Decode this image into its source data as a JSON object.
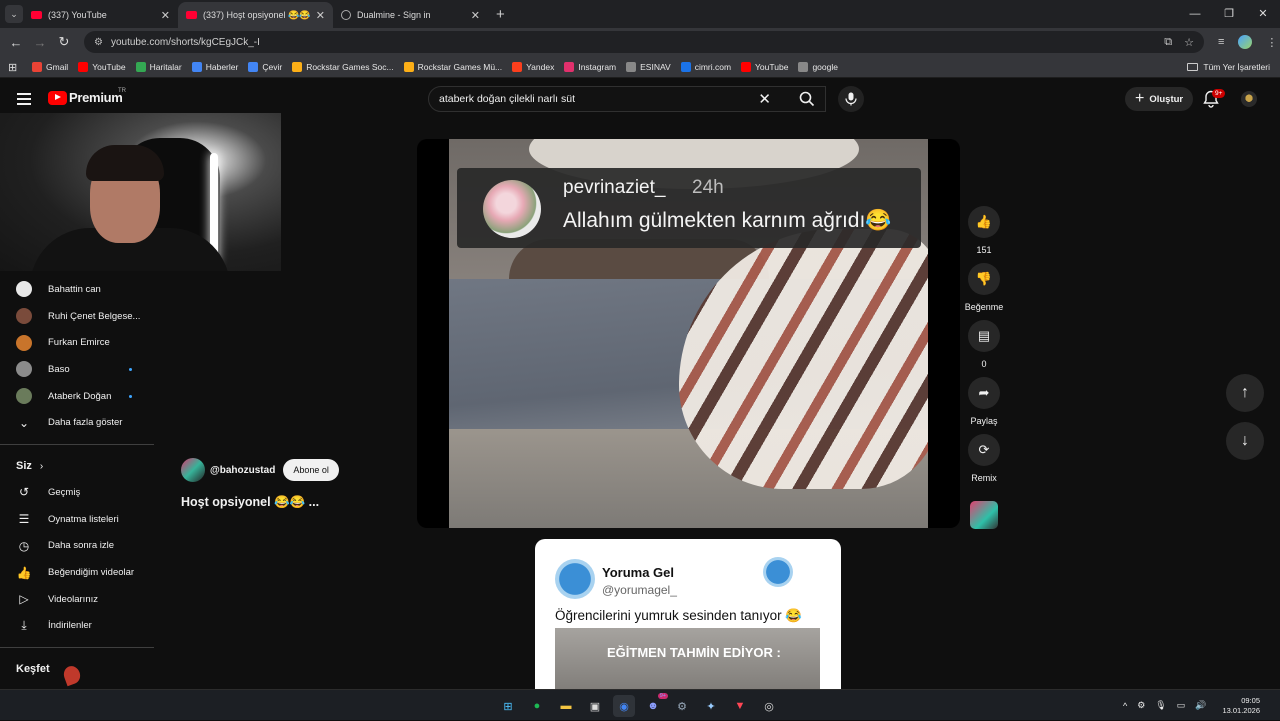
{
  "browser": {
    "tabs": [
      {
        "title": "(337) YouTube",
        "active": false
      },
      {
        "title": "(337) Hoşt opsiyonel 😂😂",
        "active": true
      },
      {
        "title": "Dualmine - Sign in",
        "active": false
      }
    ],
    "url": "youtube.com/shorts/kgCEgJCk_-I",
    "bookmarks": [
      "Gmail",
      "YouTube",
      "Haritalar",
      "Haberler",
      "Çevir",
      "Rockstar Games Soc...",
      "Rockstar Games Mü...",
      "Yandex",
      "Instagram",
      "ESINAV",
      "cimri.com",
      "YouTube",
      "google"
    ],
    "bookmark_colors": [
      "#ea4335",
      "#ff0000",
      "#34a853",
      "#4285f4",
      "#4285f4",
      "#fcaf17",
      "#fcaf17",
      "#fc3f1d",
      "#e1306c",
      "#888888",
      "#1b73e8",
      "#ff0000",
      "#888888"
    ],
    "all_bookmarks": "Tüm Yer İşaretleri"
  },
  "youtube": {
    "logo_text": "Premium",
    "region": "TR",
    "search_query": "ataberk doğan çilekli narlı süt",
    "create_label": "Oluştur",
    "notif_badge": "9+"
  },
  "sidebar": {
    "subscriptions": [
      {
        "label": "Bahattin can",
        "color": "#e8e8e8",
        "dot": false
      },
      {
        "label": "Ruhi Çenet Belgese...",
        "color": "#7a4b3b",
        "dot": false
      },
      {
        "label": "Furkan Emirce",
        "color": "#c8742b",
        "dot": false
      },
      {
        "label": "Baso",
        "color": "#8b8b8b",
        "dot": true
      },
      {
        "label": "Ataberk Doğan",
        "color": "#6a7b5b",
        "dot": true
      }
    ],
    "show_more": "Daha fazla göster",
    "you_header": "Siz",
    "you_items": [
      {
        "label": "Geçmiş",
        "icon": "history-icon",
        "glyph": "↺"
      },
      {
        "label": "Oynatma listeleri",
        "icon": "playlists-icon",
        "glyph": "☰"
      },
      {
        "label": "Daha sonra izle",
        "icon": "clock-icon",
        "glyph": "◷"
      },
      {
        "label": "Beğendiğim videolar",
        "icon": "thumbs-up-icon",
        "glyph": "👍"
      },
      {
        "label": "Videolarınız",
        "icon": "your-videos-icon",
        "glyph": "▷"
      },
      {
        "label": "İndirilenler",
        "icon": "download-icon",
        "glyph": "⤓"
      }
    ],
    "explore_header": "Keşfet"
  },
  "short": {
    "channel": "@bahozustad",
    "subscribe_label": "Abone ol",
    "title": "Hoşt opsiyonel 😂😂 ...",
    "overlay_user": "pevrinaziet_",
    "overlay_time": "24h",
    "overlay_comment": "Allahım gülmekten karnım ağrıdı😂",
    "likes": "151",
    "dislike_label": "Beğenme",
    "comments": "0",
    "share_label": "Paylaş",
    "remix_label": "Remix"
  },
  "next_short": {
    "name": "Yoruma Gel",
    "handle": "@yorumagel_",
    "text": "Öğrencilerini yumruk sesinden tanıyor 😂",
    "image_text": "EĞİTMEN TAHMİN EDİYOR :"
  },
  "taskbar": {
    "time": "09:05",
    "date": "13.01.2026",
    "discord_badge": "9+"
  }
}
